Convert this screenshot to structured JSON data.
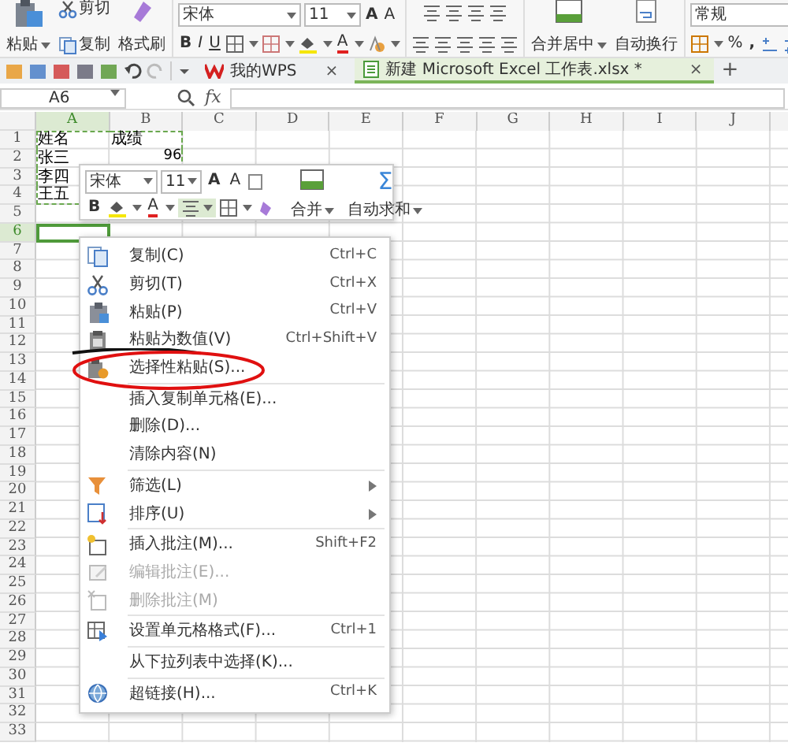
{
  "ribbon": {
    "paste": "粘贴",
    "cut": "剪切",
    "copy": "复制",
    "format_painter": "格式刷",
    "font_name": "宋体",
    "font_size": "11",
    "grow_font": "A",
    "shrink_font": "A",
    "bold": "B",
    "italic": "I",
    "underline": "U",
    "font_color": "A",
    "merge_center": "合并居中",
    "wrap_text": "自动换行",
    "number_format": "常规",
    "percent": "%",
    "comma": ","
  },
  "tabs": [
    {
      "label": "我的WPS",
      "selected": false,
      "close": "×"
    },
    {
      "label": "新建 Microsoft Excel 工作表.xlsx *",
      "selected": true,
      "close": "×"
    }
  ],
  "new_tab": "+",
  "formula_bar": {
    "name_box": "A6",
    "fx": "fx"
  },
  "sheet": {
    "columns": [
      {
        "label": "A",
        "selected": true
      },
      {
        "label": "B",
        "selected": false
      },
      {
        "label": "C",
        "selected": false
      },
      {
        "label": "D",
        "selected": false
      },
      {
        "label": "E",
        "selected": false
      },
      {
        "label": "F",
        "selected": false
      },
      {
        "label": "G",
        "selected": false
      },
      {
        "label": "H",
        "selected": false
      },
      {
        "label": "I",
        "selected": false
      },
      {
        "label": "J",
        "selected": false
      }
    ],
    "rows": [
      {
        "label": "1",
        "selected": false,
        "cells": [
          {
            "kind": "text",
            "text": "姓名",
            "copied": true
          },
          {
            "kind": "text",
            "text": "成绩",
            "copied": true
          }
        ]
      },
      {
        "label": "2",
        "selected": false,
        "cells": [
          {
            "kind": "text",
            "text": "张三",
            "copied": true
          },
          {
            "kind": "number",
            "text": "96",
            "copied": true
          }
        ]
      },
      {
        "label": "3",
        "selected": false,
        "cells": [
          {
            "kind": "text",
            "text": "李四",
            "copied": true
          }
        ]
      },
      {
        "label": "4",
        "selected": false,
        "cells": [
          {
            "kind": "text",
            "text": "王五",
            "copied": true
          }
        ]
      },
      {
        "label": "5",
        "selected": false
      },
      {
        "label": "6",
        "selected": true
      },
      {
        "label": "7",
        "selected": false
      },
      {
        "label": "8",
        "selected": false
      },
      {
        "label": "9",
        "selected": false
      },
      {
        "label": "10",
        "selected": false
      },
      {
        "label": "11",
        "selected": false
      },
      {
        "label": "12",
        "selected": false
      },
      {
        "label": "13",
        "selected": false
      },
      {
        "label": "14",
        "selected": false
      },
      {
        "label": "15",
        "selected": false
      },
      {
        "label": "16",
        "selected": false
      },
      {
        "label": "17",
        "selected": false
      },
      {
        "label": "18",
        "selected": false
      },
      {
        "label": "19",
        "selected": false
      },
      {
        "label": "20",
        "selected": false
      },
      {
        "label": "21",
        "selected": false
      },
      {
        "label": "22",
        "selected": false
      },
      {
        "label": "23",
        "selected": false
      },
      {
        "label": "24",
        "selected": false
      },
      {
        "label": "25",
        "selected": false
      },
      {
        "label": "26",
        "selected": false
      },
      {
        "label": "27",
        "selected": false
      },
      {
        "label": "28",
        "selected": false
      },
      {
        "label": "29",
        "selected": false
      },
      {
        "label": "30",
        "selected": false
      },
      {
        "label": "31",
        "selected": false
      },
      {
        "label": "32",
        "selected": false
      },
      {
        "label": "33",
        "selected": false
      }
    ]
  },
  "mini_toolbar": {
    "font_name": "宋体",
    "font_size": "11",
    "grow_font": "A",
    "shrink_font": "A",
    "bold": "B",
    "font_color": "A",
    "align_active": true,
    "merge": "合并",
    "autosum_symbol": "Σ",
    "autosum": "自动求和"
  },
  "context_menu": [
    {
      "kind": "item",
      "label": "复制(C)",
      "shortcut": "Ctrl+C",
      "disabled": false
    },
    {
      "kind": "item",
      "label": "剪切(T)",
      "shortcut": "Ctrl+X",
      "disabled": false
    },
    {
      "kind": "item",
      "label": "粘贴(P)",
      "shortcut": "Ctrl+V",
      "disabled": false
    },
    {
      "kind": "item",
      "label": "粘贴为数值(V)",
      "shortcut": "Ctrl+Shift+V",
      "disabled": false
    },
    {
      "kind": "item",
      "label": "选择性粘贴(S)...",
      "disabled": false,
      "annotated": true
    },
    {
      "kind": "separator"
    },
    {
      "kind": "item",
      "label": "插入复制单元格(E)...",
      "disabled": false
    },
    {
      "kind": "item",
      "label": "删除(D)...",
      "disabled": false
    },
    {
      "kind": "item",
      "label": "清除内容(N)",
      "disabled": false
    },
    {
      "kind": "separator"
    },
    {
      "kind": "item",
      "label": "筛选(L)",
      "disabled": false,
      "submenu": true
    },
    {
      "kind": "item",
      "label": "排序(U)",
      "disabled": false,
      "submenu": true
    },
    {
      "kind": "separator"
    },
    {
      "kind": "item",
      "label": "插入批注(M)...",
      "shortcut": "Shift+F2",
      "disabled": false
    },
    {
      "kind": "item",
      "label": "编辑批注(E)...",
      "disabled": true
    },
    {
      "kind": "item",
      "label": "删除批注(M)",
      "disabled": true
    },
    {
      "kind": "separator"
    },
    {
      "kind": "item",
      "label": "设置单元格格式(F)...",
      "shortcut": "Ctrl+1",
      "disabled": false
    },
    {
      "kind": "separator"
    },
    {
      "kind": "item",
      "label": "从下拉列表中选择(K)...",
      "disabled": false
    },
    {
      "kind": "separator"
    },
    {
      "kind": "item",
      "label": "超链接(H)...",
      "shortcut": "Ctrl+K",
      "disabled": false
    }
  ]
}
